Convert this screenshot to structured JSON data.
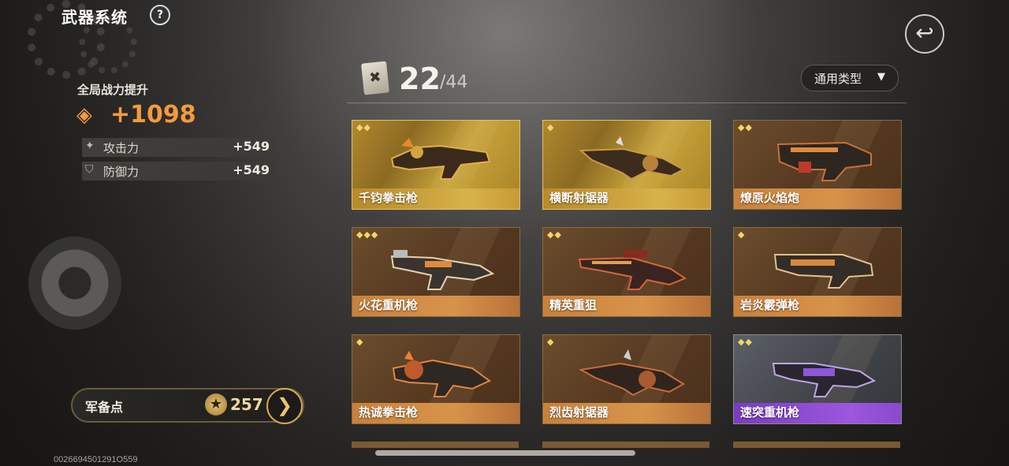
{
  "header": {
    "title": "武器系统",
    "help": "?"
  },
  "boost": {
    "label": "全局战力提升",
    "value": "+1098",
    "stats": [
      {
        "label": "攻击力",
        "value": "+549",
        "icon": "gun-icon"
      },
      {
        "label": "防御力",
        "value": "+549",
        "icon": "shield-icon"
      }
    ]
  },
  "reserve": {
    "label": "军备点",
    "value": "257"
  },
  "uid": "0026694501291O559",
  "collection": {
    "current": "22",
    "total": "/44"
  },
  "filter": {
    "label": "通用类型"
  },
  "colors": {
    "accent": "#f39a3f",
    "gold": "#d7b24a",
    "purple": "#9c56e0",
    "orange": "#d8934a"
  },
  "weapons": [
    {
      "name": "千钧拳击枪",
      "stars": "◆◆",
      "rarity": "gold"
    },
    {
      "name": "横断射锯器",
      "stars": "◆",
      "rarity": "gold"
    },
    {
      "name": "燎原火焰炮",
      "stars": "◆◆",
      "rarity": "orange"
    },
    {
      "name": "火花重机枪",
      "stars": "◆◆◆",
      "rarity": "orange"
    },
    {
      "name": "精英重狙",
      "stars": "◆◆",
      "rarity": "orange"
    },
    {
      "name": "岩炎霰弹枪",
      "stars": "◆",
      "rarity": "orange"
    },
    {
      "name": "热诚拳击枪",
      "stars": "◆",
      "rarity": "orange"
    },
    {
      "name": "烈齿射锯器",
      "stars": "◆",
      "rarity": "orange"
    },
    {
      "name": "速突重机枪",
      "stars": "◆◆",
      "rarity": "purple"
    }
  ]
}
